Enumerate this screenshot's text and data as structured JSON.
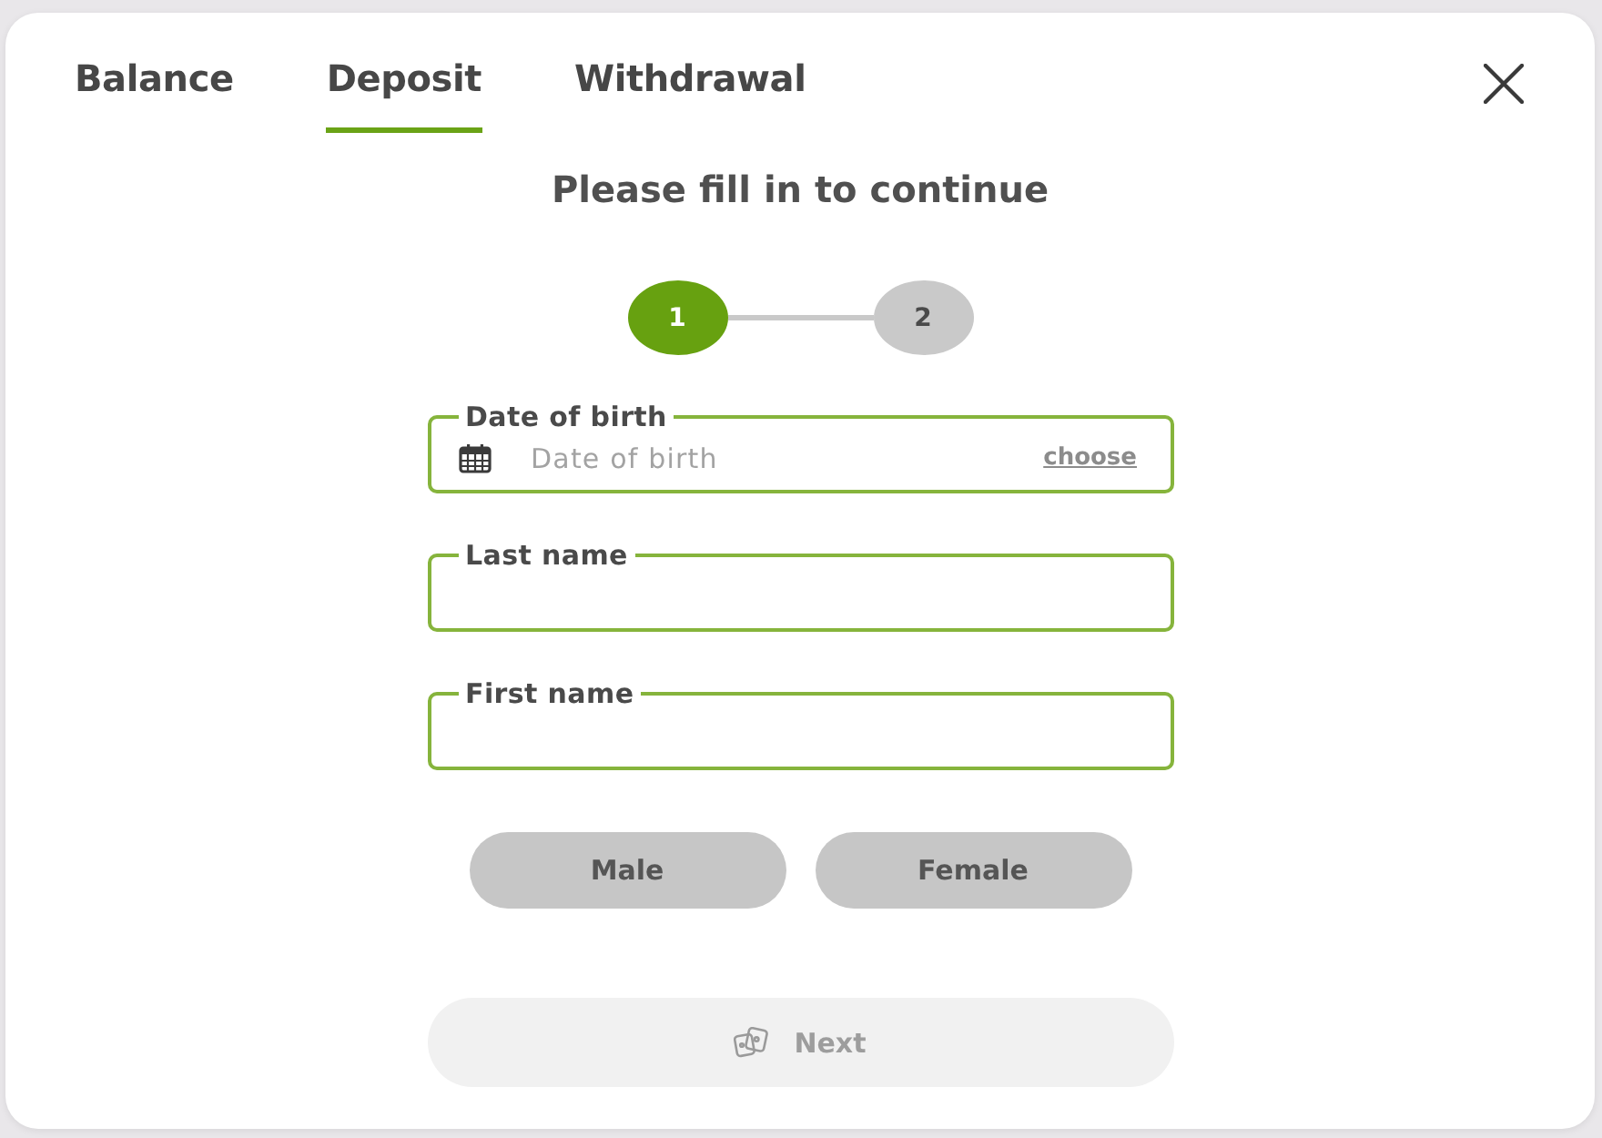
{
  "tabs": [
    {
      "label": "Balance",
      "selected": false
    },
    {
      "label": "Deposit",
      "selected": true
    },
    {
      "label": "Withdrawal",
      "selected": false
    }
  ],
  "title": "Please fill in to continue",
  "steps": [
    {
      "label": "1",
      "active": true
    },
    {
      "label": "2",
      "active": false
    }
  ],
  "fields": [
    {
      "kind": "date",
      "label": "Date of birth",
      "placeholder": "Date of birth",
      "action": "choose"
    },
    {
      "kind": "text",
      "label": "Last name"
    },
    {
      "kind": "text",
      "label": "First name"
    }
  ],
  "gender_options": [
    {
      "label": "Male",
      "selected": false
    },
    {
      "label": "Female",
      "selected": false
    }
  ],
  "next_button": {
    "label": "Next",
    "disabled": true
  }
}
